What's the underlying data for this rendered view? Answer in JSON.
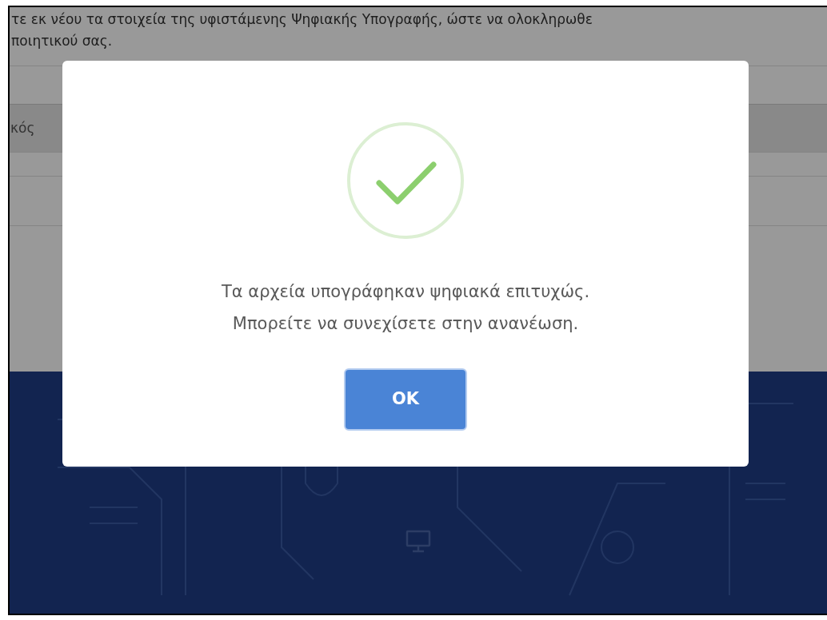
{
  "page": {
    "intro_lines": [
      "τε εκ νέου τα στοιχεία της υφιστάμενης Ψηφιακής Υπογραφής, ώστε να ολοκληρωθε",
      "ποιητικού σας."
    ],
    "table_header_cell": "κός"
  },
  "modal": {
    "kind": "success",
    "message_lines": [
      "Τα αρχεία υπογράφηκαν ψηφιακά επιτυχώς.",
      "Μπορείτε να συνεχίσετε στην ανανέωση."
    ],
    "button": "OK"
  }
}
